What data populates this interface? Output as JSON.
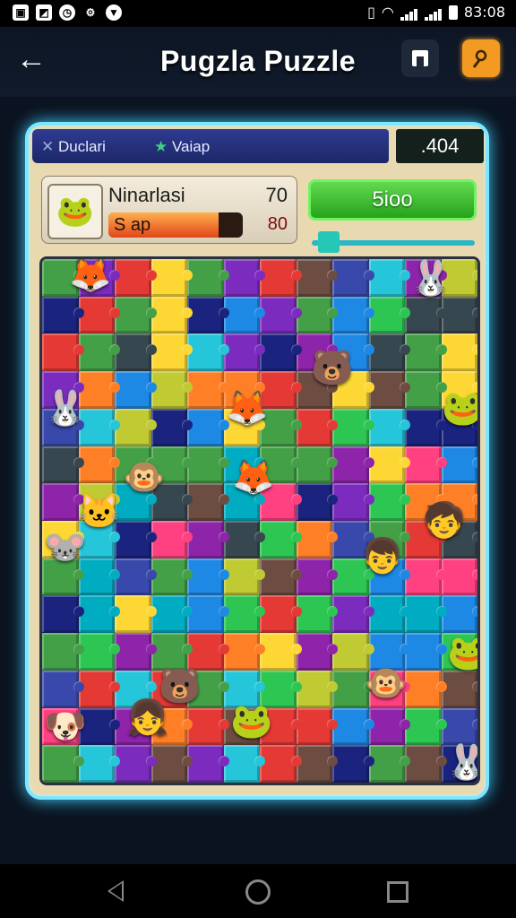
{
  "status_bar": {
    "time": "83:08"
  },
  "app_bar": {
    "title": "Pugzla Puzzle"
  },
  "header": {
    "left_label": "Duclari",
    "center_label": "Vaiap",
    "score": ".404"
  },
  "player_card": {
    "name": "Ninarlasi",
    "value": "70",
    "progress_label": "S ap",
    "progress": 0.82,
    "badge": "80"
  },
  "action": {
    "button_label": "5ioo",
    "slider_level": 0.05
  },
  "board": {
    "columns": 12,
    "rows": 14,
    "colors": [
      "#2dc653",
      "#e53935",
      "#1e88e5",
      "#fdd835",
      "#8e24aa",
      "#ff7f27",
      "#26c6da",
      "#43a047",
      "#7b2cbf",
      "#3949ab",
      "#1a237e",
      "#ff4081",
      "#c0ca33",
      "#00acc1",
      "#6d4c41",
      "#37474f"
    ]
  }
}
